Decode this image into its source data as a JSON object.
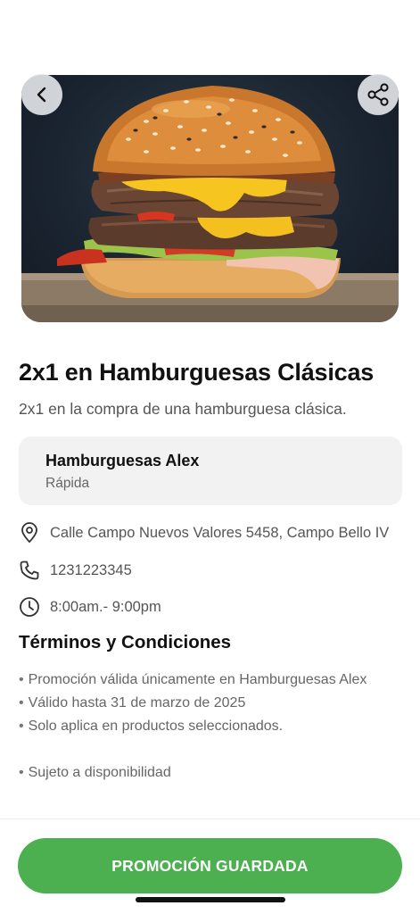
{
  "hero": {
    "image_alt": "Hamburguesa doble con queso",
    "back_icon": "chevron-left-icon",
    "share_icon": "share-icon"
  },
  "promo": {
    "title": "2x1 en Hamburguesas Clásicas",
    "subtitle": "2x1 en la compra de una hamburguesa clásica."
  },
  "store": {
    "name": "Hamburguesas Alex",
    "category": "Rápida"
  },
  "info": {
    "address": "Calle Campo Nuevos Valores 5458, Campo Bello IV",
    "phone": "1231223345",
    "hours": "8:00am.- 9:00pm"
  },
  "terms": {
    "title": "Términos y Condiciones",
    "items": [
      "Promoción válida únicamente en Hamburguesas Alex",
      "Válido hasta 31 de marzo de 2025",
      "Solo aplica en productos seleccionados.",
      "Sujeto a disponibilidad"
    ]
  },
  "cta": {
    "label": "PROMOCIÓN GUARDADA"
  },
  "colors": {
    "accent": "#4caf50",
    "text_primary": "#111111",
    "text_secondary": "#555555",
    "card_bg": "#f2f2f2"
  }
}
